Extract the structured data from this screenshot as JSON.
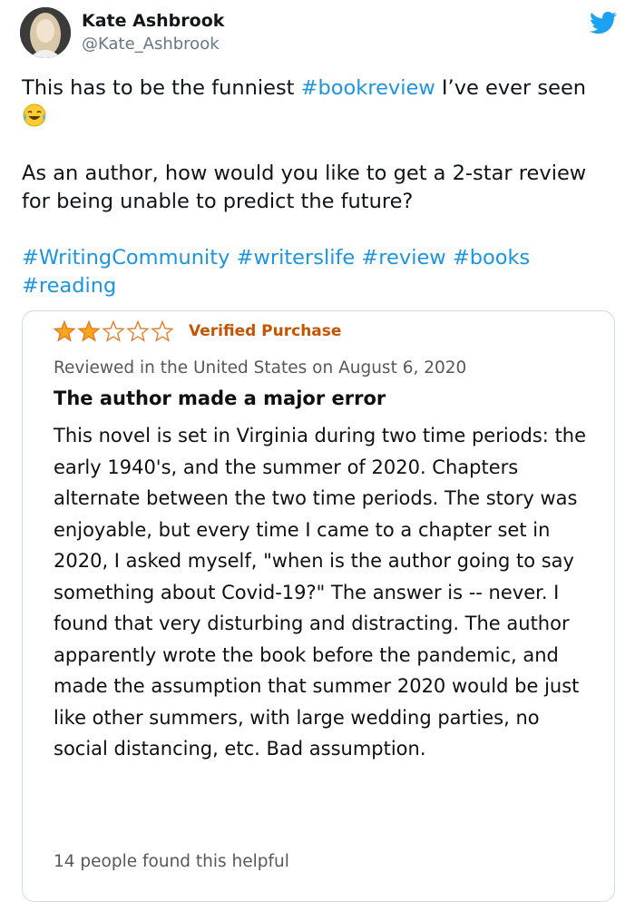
{
  "tweet": {
    "author_name": "Kate Ashbrook",
    "author_handle": "@Kate_Ashbrook",
    "icons": {
      "avatar": "profile-photo",
      "platform": "twitter-bird-icon",
      "emoji": "tears-of-joy-emoji"
    },
    "text_line1_before": "This has to be the funniest ",
    "text_line1_hashtag": "#bookreview",
    "text_line1_after": " I’ve ever seen",
    "text_paragraph2": "As an author, how would you like to get a 2-star review for being unable to predict the future?",
    "hashtags": [
      "#WritingCommunity",
      "#writerslife",
      "#review",
      "#books",
      "#reading"
    ],
    "colors": {
      "link": "#1b95e0",
      "brand": "#1da1f2",
      "handle": "#657786"
    }
  },
  "review": {
    "rating": 2,
    "rating_max": 5,
    "verified_label": "Verified Purchase",
    "meta": "Reviewed in the United States on August 6, 2020",
    "title": "The author made a major error",
    "body": "This novel is set in Virginia during two time periods: the early 1940's, and the summer of 2020. Chapters alternate between the two time periods. The story was enjoyable, but every time I came to a chapter set in 2020, I asked myself, \"when is the author going to say something about Covid-19?\" The answer is -- never. I found that very disturbing and distracting. The author apparently wrote the book before the pandemic, and made the assumption that summer 2020 would be just like other summers, with large wedding parties, no social distancing, etc. Bad assumption.",
    "helpful": "14 people found this helpful",
    "colors": {
      "star": "#ffa41c",
      "verified": "#c45500"
    }
  }
}
